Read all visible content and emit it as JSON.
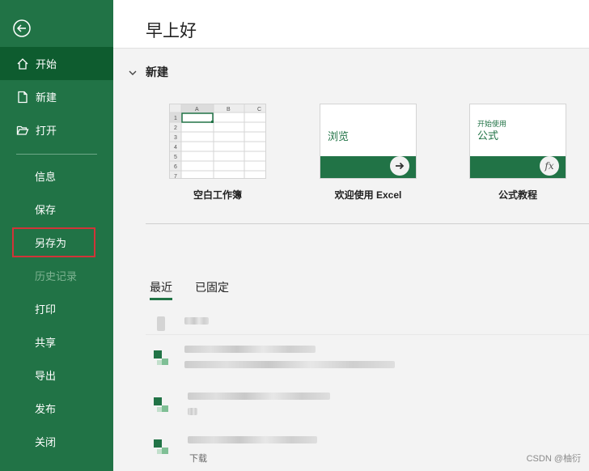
{
  "sidebar": {
    "items": [
      {
        "label": "开始"
      },
      {
        "label": "新建"
      },
      {
        "label": "打开"
      },
      {
        "label": "信息"
      },
      {
        "label": "保存"
      },
      {
        "label": "另存为"
      },
      {
        "label": "历史记录"
      },
      {
        "label": "打印"
      },
      {
        "label": "共享"
      },
      {
        "label": "导出"
      },
      {
        "label": "发布"
      },
      {
        "label": "关闭"
      }
    ],
    "active": "开始",
    "disabled": "历史记录",
    "highlighted": "另存为"
  },
  "header": {
    "greeting": "早上好"
  },
  "new_section": {
    "title": "新建",
    "templates": [
      {
        "name": "空白工作簿",
        "columns": [
          "A",
          "B",
          "C"
        ],
        "rows": [
          "1",
          "2",
          "3",
          "4",
          "5",
          "6",
          "7"
        ]
      },
      {
        "name": "欢迎使用 Excel",
        "thumb_text": "浏览"
      },
      {
        "name": "公式教程",
        "thumb_small": "开始使用",
        "thumb_big": "公式",
        "thumb_symbol": "fx"
      }
    ]
  },
  "tabs": {
    "recent": "最近",
    "pinned": "已固定"
  },
  "recent_partial_text": "下载",
  "watermark": "CSDN @柚衍",
  "colors": {
    "brand_green": "#217346",
    "active_item": "#0e5c2f",
    "highlight_border": "#d13438"
  }
}
